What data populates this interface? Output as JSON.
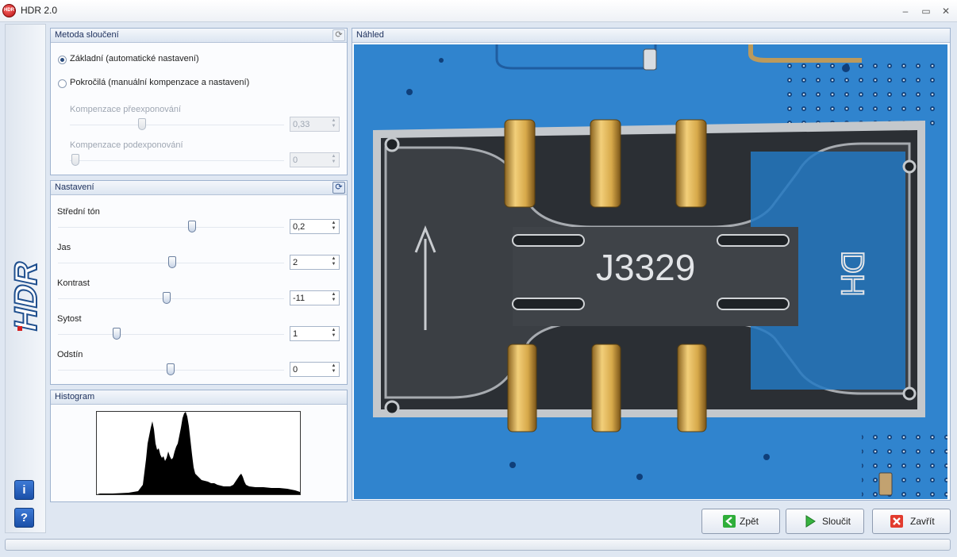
{
  "window": {
    "title": "HDR 2.0",
    "icon_text": "HDR",
    "min": "–",
    "max": "▭",
    "close": "✕"
  },
  "brand": {
    "logo_text": "HDR",
    "info_button": "i",
    "help_button": "?"
  },
  "merge": {
    "title": "Metoda sloučení",
    "basic_label": "Základní (automatické nastavení)",
    "advanced_label": "Pokročilá (manuální kompenzace a nastavení)",
    "over_label": "Kompenzace přeexponování",
    "over_value": "0,33",
    "under_label": "Kompenzace podexponování",
    "under_value": "0"
  },
  "settings": {
    "title": "Nastavení",
    "items": [
      {
        "label": "Střední tón",
        "value": "0,2"
      },
      {
        "label": "Jas",
        "value": "2"
      },
      {
        "label": "Kontrast",
        "value": "-11"
      },
      {
        "label": "Sytost",
        "value": "1"
      },
      {
        "label": "Odstín",
        "value": "0"
      }
    ]
  },
  "histogram": {
    "title": "Histogram"
  },
  "preview": {
    "title": "Náhled",
    "chip_label": "J3329",
    "chip_mark": "DH"
  },
  "buttons": {
    "back": "Zpět",
    "merge": "Sloučit",
    "close": "Zavřít"
  },
  "colors": {
    "accent": "#1c2f5c",
    "pcb_blue": "#2b7fc9",
    "gold": "#d7a94a"
  }
}
